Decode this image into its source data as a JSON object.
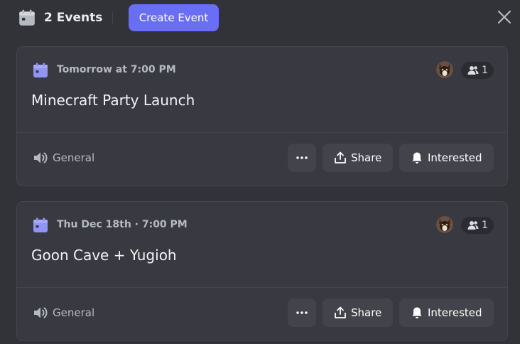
{
  "header": {
    "event_count": "2 Events",
    "create_label": "Create Event"
  },
  "events": [
    {
      "date": "Tomorrow at 7:00 PM",
      "title": "Minecraft Party Launch",
      "interested_count": "1",
      "channel": "General",
      "share_label": "Share",
      "interested_label": "Interested"
    },
    {
      "date": "Thu Dec 18th · 7:00 PM",
      "title": "Goon Cave + Yugioh",
      "interested_count": "1",
      "channel": "General",
      "share_label": "Share",
      "interested_label": "Interested"
    }
  ],
  "colors": {
    "background": "#323339",
    "card": "#393a41",
    "accent": "#6a6ef5",
    "date_icon": "#8e95f5"
  },
  "icons": [
    "calendar-icon",
    "close-icon",
    "people-icon",
    "speaker-icon",
    "more-icon",
    "share-icon",
    "bell-icon"
  ]
}
